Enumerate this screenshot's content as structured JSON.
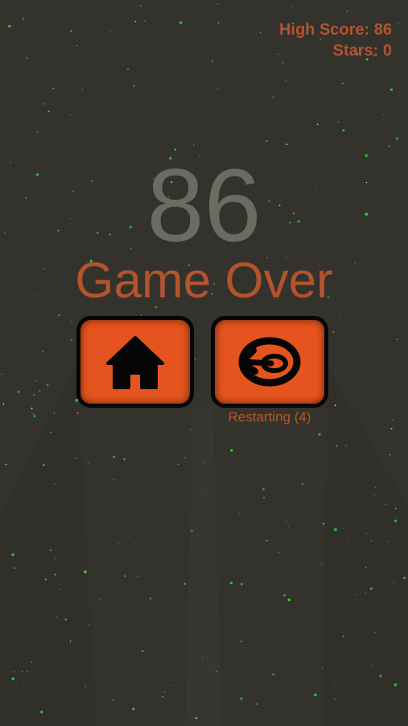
{
  "hud": {
    "high_score_label": "High Score: 86",
    "stars_label": "Stars: 0"
  },
  "score": "86",
  "game_over_text": "Game Over",
  "buttons": {
    "home_icon": "home-icon",
    "restart_icon": "restart-icon",
    "restart_label": "Restarting (4)"
  },
  "colors": {
    "background": "#33322d",
    "accent": "#b5532c",
    "button_fill": "#e5541e",
    "button_border": "#060606",
    "score": "#6c6b62",
    "stars_white": "#ffffff",
    "stars_green": "#29d62c"
  }
}
